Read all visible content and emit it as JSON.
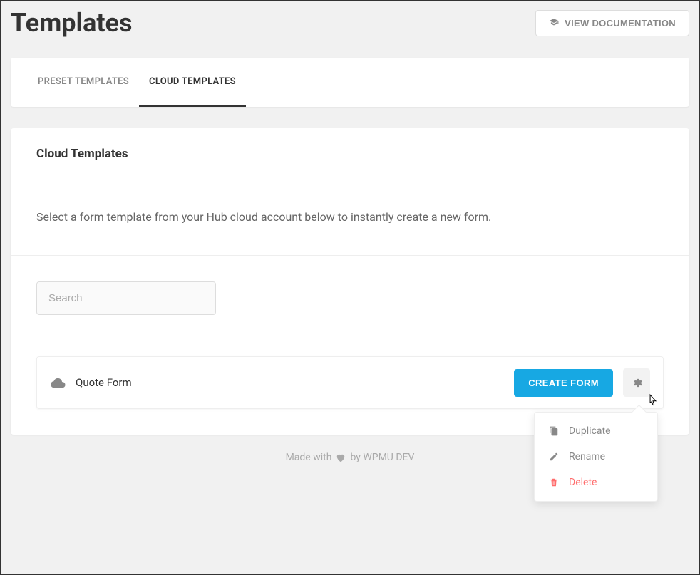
{
  "header": {
    "title": "Templates",
    "doc_button": "VIEW DOCUMENTATION"
  },
  "tabs": {
    "preset": "PRESET TEMPLATES",
    "cloud": "CLOUD TEMPLATES"
  },
  "section": {
    "title": "Cloud Templates",
    "description": "Select a form template from your Hub cloud account below to instantly create a new form."
  },
  "search": {
    "placeholder": "Search"
  },
  "template": {
    "name": "Quote Form",
    "create_button": "CREATE FORM"
  },
  "dropdown": {
    "duplicate": "Duplicate",
    "rename": "Rename",
    "delete": "Delete"
  },
  "footer": {
    "prefix": "Made with",
    "suffix": "by WPMU DEV"
  }
}
